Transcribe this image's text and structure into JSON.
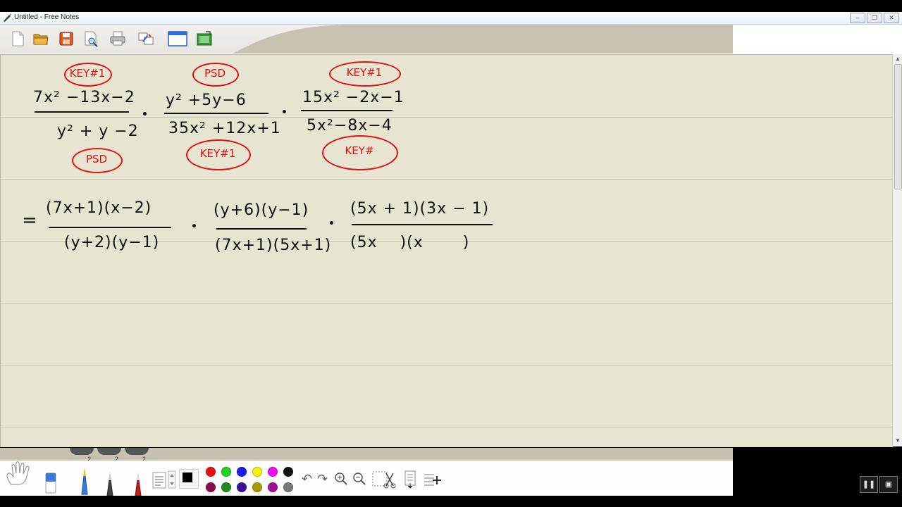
{
  "window": {
    "title": "Untitled - Free Notes",
    "controls": [
      "–",
      "❐",
      "✕"
    ]
  },
  "toolbar": {
    "icons": [
      "new-file-icon",
      "open-folder-icon",
      "save-icon",
      "print-preview-icon",
      "print-icon",
      "transfer-icon",
      "window-icon",
      "screenshot-icon"
    ]
  },
  "notes": {
    "row1": {
      "frac1": {
        "numerator": "7x² −13x−2",
        "denominator": "y² + y −2",
        "label_top": "KEY#1",
        "label_bottom": "PSD"
      },
      "frac2": {
        "numerator": "y² +5y−6",
        "denominator": "35x² +12x+1",
        "label_top": "PSD",
        "label_bottom": "KEY#1"
      },
      "frac3": {
        "numerator": "15x² −2x−1",
        "denominator": "5x²−8x−4",
        "label_top": "KEY#1",
        "label_bottom": "KEY#"
      }
    },
    "row2": {
      "equals": "=",
      "frac1": {
        "numerator": "(7x+1)(x−2)",
        "denominator": "(y+2)(y−1)"
      },
      "frac2": {
        "numerator": "(y+6)(y−1)",
        "denominator": "(7x+1)(5x+1)"
      },
      "frac3": {
        "numerator": "(5x + 1)(3x − 1)",
        "denominator": "(5x    )(x       )"
      }
    },
    "multiply_dot": "·"
  },
  "bottom_toolbar": {
    "pen_counts": [
      "2",
      "2",
      "2"
    ],
    "colors_row1": [
      "#e81010",
      "#21d321",
      "#1b1bef",
      "#f4f400",
      "#f010f0",
      "#111111"
    ],
    "colors_row2": [
      "#8a0e4a",
      "#1f8a1f",
      "#3a0f9a",
      "#a69b00",
      "#a0109a",
      "#7a7a7a"
    ],
    "current_color": "#000000"
  },
  "corner": [
    "❚❚",
    "▣"
  ]
}
